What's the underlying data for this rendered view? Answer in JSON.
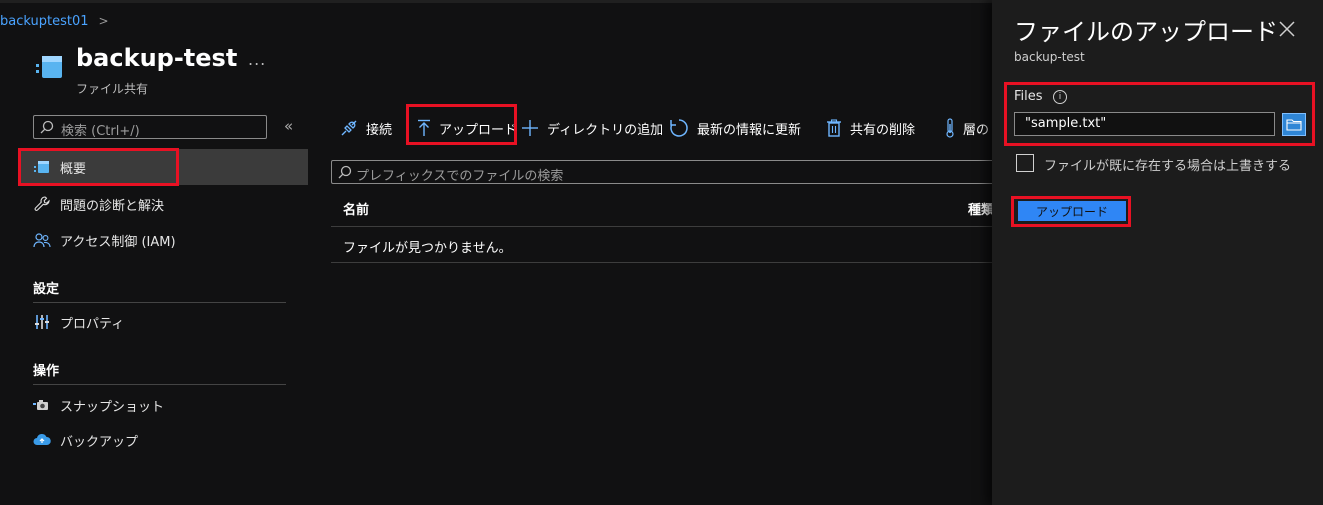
{
  "breadcrumb": {
    "parent": "backuptest01",
    "separator": ">"
  },
  "resource": {
    "title": "backup-test",
    "subtitle": "ファイル共有",
    "more": "..."
  },
  "sidebar": {
    "search_placeholder": "検索 (Ctrl+/)",
    "collapse": "«",
    "items": [
      {
        "label": "概要",
        "icon": "file-share-icon"
      },
      {
        "label": "問題の診断と解決",
        "icon": "wrench-icon"
      },
      {
        "label": "アクセス制御 (IAM)",
        "icon": "people-icon"
      }
    ],
    "sections": [
      {
        "heading": "設定",
        "items": [
          {
            "label": "プロパティ",
            "icon": "properties-icon"
          }
        ]
      },
      {
        "heading": "操作",
        "items": [
          {
            "label": "スナップショット",
            "icon": "snapshot-icon"
          },
          {
            "label": "バックアップ",
            "icon": "backup-icon"
          }
        ]
      }
    ]
  },
  "toolbar": {
    "connect": "接続",
    "upload": "アップロード",
    "add_directory": "ディレクトリの追加",
    "refresh": "最新の情報に更新",
    "delete_share": "共有の削除",
    "tier": "層の"
  },
  "main": {
    "search_placeholder": "プレフィックスでのファイルの検索",
    "columns": {
      "name": "名前",
      "type": "種類"
    },
    "empty_message": "ファイルが見つかりません。"
  },
  "upload_panel": {
    "title": "ファイルのアップロード",
    "subtitle": "backup-test",
    "files_label": "Files",
    "files_value": "\"sample.txt\"",
    "overwrite_label": "ファイルが既に存在する場合は上書きする",
    "overwrite_checked": false,
    "upload_button": "アップロード"
  },
  "colors": {
    "accent": "#2f86f5",
    "highlight": "#e81123",
    "link": "#4aa3ff"
  }
}
